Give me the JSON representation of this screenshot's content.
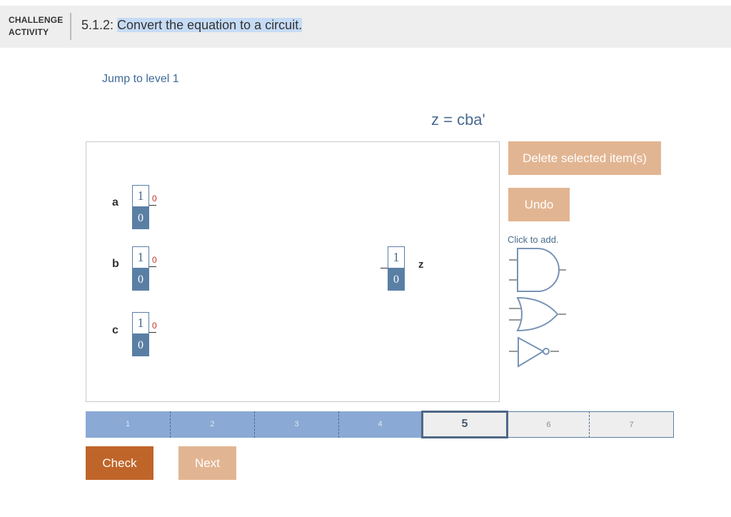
{
  "header": {
    "activity_tag_line1": "CHALLENGE",
    "activity_tag_line2": "ACTIVITY",
    "section_number": "5.1.2: ",
    "title": "Convert the equation to a circuit."
  },
  "jump_link": "Jump to level 1",
  "equation": "z = cba'",
  "inputs": [
    {
      "name": "a",
      "top_value": "1",
      "bottom_value": "0",
      "output": "0"
    },
    {
      "name": "b",
      "top_value": "1",
      "bottom_value": "0",
      "output": "0"
    },
    {
      "name": "c",
      "top_value": "1",
      "bottom_value": "0",
      "output": "0"
    }
  ],
  "output": {
    "name": "z",
    "top_value": "1",
    "bottom_value": "0"
  },
  "toolbox": {
    "delete_label": "Delete selected item(s)",
    "undo_label": "Undo",
    "click_to_add": "Click to add.",
    "gates": [
      "and-gate-icon",
      "or-gate-icon",
      "not-gate-icon"
    ]
  },
  "levels": [
    {
      "label": "1",
      "state": "done"
    },
    {
      "label": "2",
      "state": "done"
    },
    {
      "label": "3",
      "state": "done"
    },
    {
      "label": "4",
      "state": "done"
    },
    {
      "label": "5",
      "state": "current"
    },
    {
      "label": "6",
      "state": "todo"
    },
    {
      "label": "7",
      "state": "todo"
    }
  ],
  "actions": {
    "check_label": "Check",
    "next_label": "Next"
  },
  "colors": {
    "accent": "#4a6b8f",
    "toggle_blue": "#5a7fa5",
    "check_button": "#c0652a",
    "light_button": "#e2b592",
    "progress_done": "#8aa9d4",
    "output_value_red": "#c0392b"
  }
}
